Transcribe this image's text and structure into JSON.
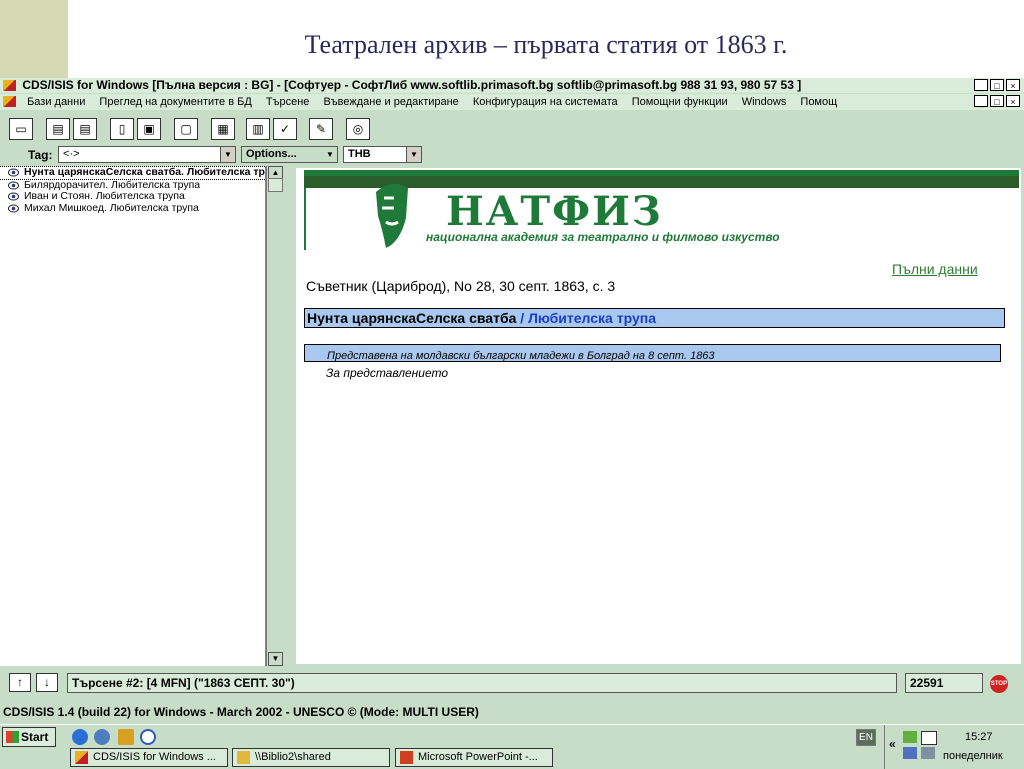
{
  "slide": {
    "title": "Театрален архив – първата статия от 1863 г."
  },
  "app": {
    "title": "CDS/ISIS for Windows [Пълна версия : BG] - [Софтуер - СофтЛиб www.softlib.primasoft.bg softlib@primasoft.bg 988 31 93, 980 57 53 ]",
    "window_buttons": [
      "_",
      "□",
      "×"
    ],
    "menu": [
      "Бази данни",
      "Преглед на документите в БД",
      "Търсене",
      "Въвеждане и редактиране",
      "Конфигурация на системата",
      "Помощни функции",
      "Windows",
      "Помощ"
    ],
    "options": {
      "tag_label": "Tag:",
      "tag_value": "<·>",
      "options_label": "Options...",
      "db_value": "THB"
    },
    "list": [
      "Нунта царянскаСелска сватба. Любителска трупа",
      "Билярдорачител. Любителска трупа",
      "Иван и Стоян. Любителска трупа",
      "Михал Мишкоед. Любителска трупа"
    ],
    "record": {
      "logo_text": "НАТФИЗ",
      "logo_subtitle": "национална академия за театрално и филмово изкуство",
      "full_data_link": "Пълни данни",
      "source": "Съветник (Цариброд), No 28, 30 септ. 1863, с. 3",
      "title_main": "Нунта царянскаСелска сватба",
      "title_sep": " / ",
      "title_author": "Любителска трупа",
      "note": "Представена на молдавски български младежи в Болград на 8 септ. 1863",
      "about": "За представлението"
    },
    "status": {
      "query": "Търсене #2: [4 MFN] (\"1863 СЕПТ. 30\")",
      "mfn": "22591",
      "stop_label": "STOP",
      "version": "CDS/ISIS 1.4 (build 22) for Windows - March 2002 - UNESCO ©  (Mode: MULTI USER)"
    }
  },
  "taskbar": {
    "start": "Start",
    "tasks": [
      "CDS/ISIS for Windows ...",
      "\\\\Biblio2\\shared",
      "Microsoft PowerPoint -..."
    ],
    "lang": "EN",
    "time": "15:27",
    "day": "понеделник",
    "chevron": "«"
  },
  "colors": {
    "app_bg": "#c8ddc8",
    "natfiz_green": "#1f7a3a",
    "highlight_blue": "#a9c8ef",
    "link_green": "#2e7d32"
  }
}
